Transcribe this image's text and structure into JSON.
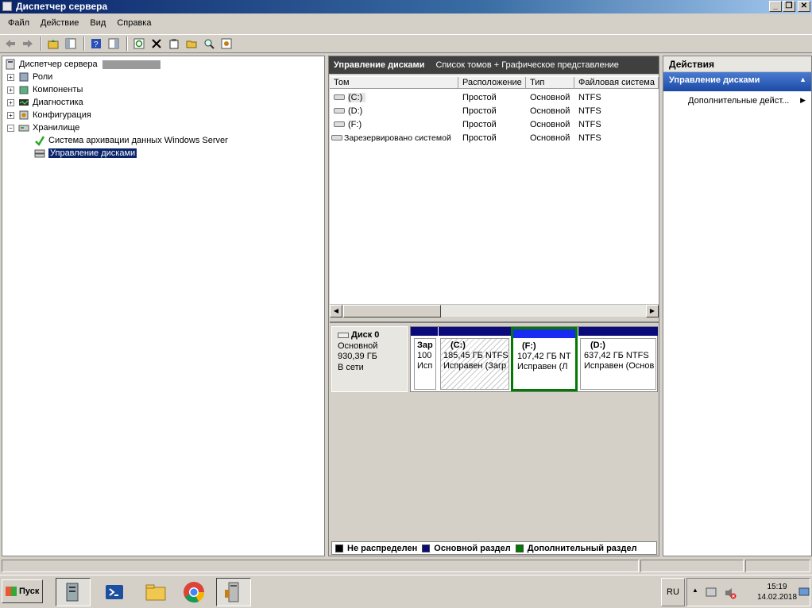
{
  "window": {
    "title": "Диспетчер сервера",
    "buttons": {
      "minimize": "_",
      "maximize": "❐",
      "close": "✕"
    }
  },
  "menu": [
    "Файл",
    "Действие",
    "Вид",
    "Справка"
  ],
  "toolbar": {
    "icons": [
      "back-icon",
      "forward-icon",
      "up-folder-icon",
      "show-hide-tree-icon",
      "help-icon",
      "show-hide-action-pane-icon",
      "refresh-icon",
      "delete-icon",
      "properties-icon",
      "open-icon",
      "search-icon",
      "settings-icon"
    ]
  },
  "tree": {
    "root": "Диспетчер сервера",
    "items": [
      {
        "label": "Роли",
        "expander": "+"
      },
      {
        "label": "Компоненты",
        "expander": "+"
      },
      {
        "label": "Диагностика",
        "expander": "+"
      },
      {
        "label": "Конфигурация",
        "expander": "+"
      },
      {
        "label": "Хранилище",
        "expander": "−"
      }
    ],
    "storage_children": [
      {
        "label": "Система архивации данных Windows Server"
      },
      {
        "label": "Управление дисками"
      }
    ]
  },
  "center": {
    "title": "Управление дисками",
    "subtitle": "Список томов + Графическое представление",
    "columns": [
      "Том",
      "Расположение",
      "Тип",
      "Файловая система"
    ],
    "volumes": [
      {
        "name": "(C:)",
        "layout": "Простой",
        "type": "Основной",
        "fs": "NTFS"
      },
      {
        "name": "(D:)",
        "layout": "Простой",
        "type": "Основной",
        "fs": "NTFS"
      },
      {
        "name": "(F:)",
        "layout": "Простой",
        "type": "Основной",
        "fs": "NTFS"
      },
      {
        "name": "Зарезервировано системой",
        "layout": "Простой",
        "type": "Основной",
        "fs": "NTFS"
      }
    ],
    "scroll": {
      "left": "◀",
      "right": "▶"
    }
  },
  "disk": {
    "name": "Диск 0",
    "type": "Основной",
    "size": "930,39 ГБ",
    "status": "В сети",
    "partitions": [
      {
        "title": "Зар",
        "line1": "100",
        "line2": "Исп"
      },
      {
        "title": "(C:)",
        "line1": "185,45 ГБ NTFS",
        "line2": "Исправен (Загр"
      },
      {
        "title": "(F:)",
        "line1": "107,42 ГБ NT",
        "line2": "Исправен (Л"
      },
      {
        "title": "(D:)",
        "line1": "637,42 ГБ NTFS",
        "line2": "Исправен (Основ"
      }
    ]
  },
  "legend": [
    {
      "label": "Не распределен",
      "color": "#000000"
    },
    {
      "label": "Основной раздел",
      "color": "#0a0a7a"
    },
    {
      "label": "Дополнительный раздел",
      "color": "#007a00"
    }
  ],
  "actions": {
    "title": "Действия",
    "section": "Управление дисками",
    "section_arrow": "▲",
    "item": "Дополнительные дейст...",
    "item_arrow": "▶"
  },
  "taskbar": {
    "start": "Пуск",
    "lang": "RU",
    "time": "15:19",
    "date": "14.02.2018",
    "tray_expand": "▲"
  }
}
